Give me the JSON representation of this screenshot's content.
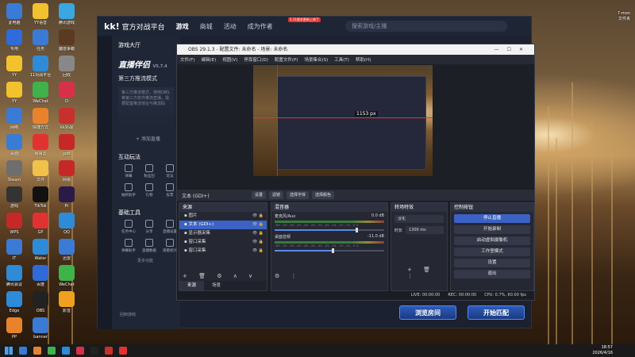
{
  "desktop": {
    "icons": [
      {
        "label": "此电脑",
        "color": "#3a7bd5"
      },
      {
        "label": "YY语音",
        "color": "#f2c12e"
      },
      {
        "label": "腾讯游戏",
        "color": "#3aa7e0"
      },
      {
        "label": "专用",
        "color": "#2f6bd9"
      },
      {
        "label": "任务",
        "color": "#3a7bd5"
      },
      {
        "label": "魔兽争霸",
        "color": "#5a3a22"
      },
      {
        "label": "YY",
        "color": "#f2c12e"
      },
      {
        "label": "11对战平台",
        "color": "#2e8bd8"
      },
      {
        "label": "回收",
        "color": "#888888"
      },
      {
        "label": "YY",
        "color": "#f2c12e"
      },
      {
        "label": "WeChat",
        "color": "#3fb24a"
      },
      {
        "label": "D",
        "color": "#d9304a"
      },
      {
        "label": "网络",
        "color": "#3a7bd5"
      },
      {
        "label": "快捷方式",
        "color": "#e8832b"
      },
      {
        "label": "kk对战",
        "color": "#c8302b"
      },
      {
        "label": "桌面",
        "color": "#3a7bd5"
      },
      {
        "label": "网易云",
        "color": "#e23131"
      },
      {
        "label": "pdf",
        "color": "#c62828"
      },
      {
        "label": "Steam",
        "color": "#6e6e6e"
      },
      {
        "label": "文件",
        "color": "#f0c24a"
      },
      {
        "label": "网易",
        "color": "#c62828"
      },
      {
        "label": "游戏",
        "color": "#333333"
      },
      {
        "label": "TikTok",
        "color": "#111111"
      },
      {
        "label": "Pr",
        "color": "#2a1a48"
      },
      {
        "label": "WPS",
        "color": "#c62828"
      },
      {
        "label": "GP",
        "color": "#e23131"
      },
      {
        "label": "QQ",
        "color": "#2e8bd8"
      },
      {
        "label": "IT",
        "color": "#3a7bd5"
      },
      {
        "label": "Water",
        "color": "#2e8bd8"
      },
      {
        "label": "迅雷",
        "color": "#3a7bd5"
      },
      {
        "label": "腾讯会议",
        "color": "#2e8bd8"
      },
      {
        "label": "百度",
        "color": "#2e6bd9"
      },
      {
        "label": "WeChat",
        "color": "#3fb24a"
      },
      {
        "label": "Edge",
        "color": "#2e8bd8"
      },
      {
        "label": "OBS",
        "color": "#222222"
      },
      {
        "label": "影音",
        "color": "#f0a020"
      },
      {
        "label": "PP",
        "color": "#e8832b"
      },
      {
        "label": "banner",
        "color": "#3a7bd5"
      }
    ],
    "top_right": [
      "7-mon",
      "文件夹"
    ]
  },
  "kk": {
    "logo": "kk!",
    "logo_sub": "官方对战平台",
    "nav": [
      "游戏",
      "商城",
      "活动",
      "成为作者"
    ],
    "badge": "5.11版本更新上线了",
    "sidebar_title": "游戏大厅",
    "live_logo": "直播伴侣",
    "version": "V5.7.4",
    "mode": "第三方推流模式",
    "desc": "第三方推流模式，使用OBS等第三方软件推流直播，需要配置推流地址与推流码",
    "add_scene": "+ 添加直播",
    "interact_title": "互动玩法",
    "interact_tools": [
      "弹幕",
      "粉丝团",
      "玩法",
      "抽奖助手",
      "礼物",
      "投票"
    ],
    "tools_title": "基础工具",
    "base_tools": [
      "任务中心",
      "分享",
      "直播设置",
      "弹幕助手",
      "直播数据",
      "观看统计"
    ],
    "more_label": "更多功能",
    "footer_link": "回到游戏",
    "search_placeholder": "搜索游戏/主播",
    "btn_browse": "浏览房间",
    "btn_match": "开始匹配"
  },
  "obs": {
    "title": "OBS 29.1.3 - 配置文件: 未命名 - 场景: 未命名",
    "menu": [
      "文件(F)",
      "编辑(E)",
      "视图(V)",
      "停靠窗口(D)",
      "配置文件(P)",
      "场景集合(S)",
      "工具(T)",
      "帮助(H)"
    ],
    "preview_px": "1153 px",
    "current_source": "文本 (GDI+)",
    "source_buttons": [
      "设置",
      "滤镜",
      "选择字体",
      "选择颜色"
    ],
    "docks": {
      "scenes_title": "来源",
      "mixer_title": "混音器",
      "trans_title": "转场特效",
      "ctrl_title": "控制按钮"
    },
    "sources": [
      {
        "label": "图片",
        "selected": false
      },
      {
        "label": "文本 (GDI+)",
        "selected": true
      },
      {
        "label": "显示器采集",
        "selected": false
      },
      {
        "label": "窗口采集",
        "selected": false
      },
      {
        "label": "窗口采集",
        "selected": false
      }
    ],
    "tabs": [
      "来源",
      "场景"
    ],
    "mixer": [
      {
        "name": "麦克风/Aux",
        "db": "0.0 dB",
        "level": 0.74
      },
      {
        "name": "桌面音频",
        "db": "-11.0 dB",
        "level": 0.52
      }
    ],
    "mixer_scale": "-60 -55 -50 -45 -40 -35 -30 -25 -20 -15 -10 -5 0",
    "transition": {
      "type": "淡化",
      "duration_label": "时长",
      "duration": "1300 ms"
    },
    "controls": [
      "停止直播",
      "开始录制",
      "启动虚拟摄像机",
      "工作室模式",
      "设置",
      "退出"
    ],
    "status": {
      "live": "LIVE: 00:00:00",
      "rec": "REC: 00:00:00",
      "cpu": "CPU: 0.7%, 60.00 fps"
    }
  },
  "taskbar": {
    "time": "18:57",
    "date": "2026/4/16",
    "icons": [
      "#3a7bd5",
      "#e8832b",
      "#3fb24a",
      "#2e8bd8",
      "#d9304a",
      "#222222",
      "#c8302b",
      "#e23131"
    ]
  }
}
